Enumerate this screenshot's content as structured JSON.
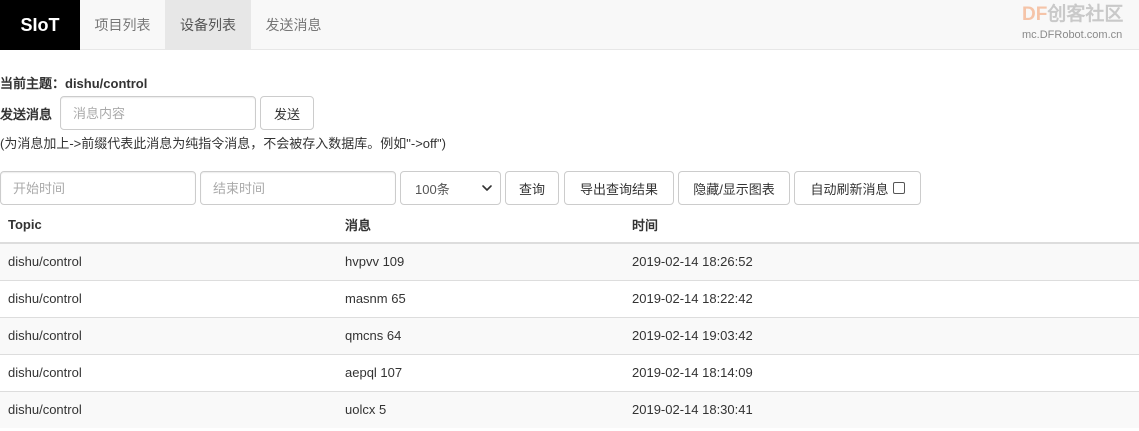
{
  "navbar": {
    "brand": "SIoT",
    "tabs": [
      {
        "label": "项目列表",
        "active": false
      },
      {
        "label": "设备列表",
        "active": true
      },
      {
        "label": "发送消息",
        "active": false
      }
    ],
    "logo_df": "DF",
    "logo_cn": "创客社区",
    "logo_url": "mc.DFRobot.com.cn"
  },
  "info": {
    "topic_label": "当前主题：dishu/control",
    "send_label": "发送消息",
    "msg_placeholder": "消息内容",
    "send_button": "发送",
    "hint": "(为消息加上->前缀代表此消息为纯指令消息，不会被存入数据库。例如\"->off\")"
  },
  "query": {
    "start_placeholder": "开始时间",
    "end_placeholder": "结束时间",
    "limit_value": "100条",
    "query_button": "查询",
    "export_button": "导出查询结果",
    "toggle_chart_button": "隐藏/显示图表",
    "auto_refresh_label": "自动刷新消息",
    "auto_refresh_checked": false
  },
  "table": {
    "headers": [
      "Topic",
      "消息",
      "时间"
    ],
    "rows": [
      [
        "dishu/control",
        "hvpvv 109",
        "2019-02-14 18:26:52"
      ],
      [
        "dishu/control",
        "masnm 65",
        "2019-02-14 18:22:42"
      ],
      [
        "dishu/control",
        "qmcns 64",
        "2019-02-14 19:03:42"
      ],
      [
        "dishu/control",
        "aepql 107",
        "2019-02-14 18:14:09"
      ],
      [
        "dishu/control",
        "uolcx 5",
        "2019-02-14 18:30:41"
      ]
    ]
  },
  "colors": {
    "brand_bg": "#000000",
    "navbar_bg": "#f8f8f8",
    "active_tab_bg": "#e7e7e7",
    "striped_row_bg": "#f9f9f9"
  }
}
